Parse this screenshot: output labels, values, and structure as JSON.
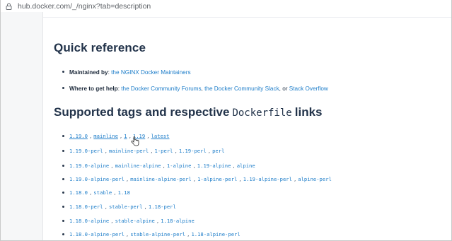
{
  "browser": {
    "url": "hub.docker.com/_/nginx?tab=description"
  },
  "quick_reference": {
    "title": "Quick reference",
    "maintained_label": "Maintained by",
    "maintained_sep": ": ",
    "maintained_value": "the NGINX Docker Maintainers",
    "help_label": "Where to get help",
    "help_sep": ": ",
    "help_link1": "the Docker Community Forums",
    "help_comma1": ", ",
    "help_link2": "the Docker Community Slack",
    "help_or": ", or ",
    "help_link3": "Stack Overflow"
  },
  "supported_tags": {
    "title_pre": "Supported tags and respective",
    "title_code": "Dockerfile",
    "title_post": "links",
    "rows": [
      {
        "tags": [
          "1.19.0",
          "mainline",
          "1",
          "1.19",
          "latest"
        ]
      },
      {
        "tags": [
          "1.19.0-perl",
          "mainline-perl",
          "1-perl",
          "1.19-perl",
          "perl"
        ]
      },
      {
        "tags": [
          "1.19.0-alpine",
          "mainline-alpine",
          "1-alpine",
          "1.19-alpine",
          "alpine"
        ]
      },
      {
        "tags": [
          "1.19.0-alpine-perl",
          "mainline-alpine-perl",
          "1-alpine-perl",
          "1.19-alpine-perl",
          "alpine-perl"
        ]
      },
      {
        "tags": [
          "1.18.0",
          "stable",
          "1.18"
        ]
      },
      {
        "tags": [
          "1.18.0-perl",
          "stable-perl",
          "1.18-perl"
        ]
      },
      {
        "tags": [
          "1.18.0-alpine",
          "stable-alpine",
          "1.18-alpine"
        ]
      },
      {
        "tags": [
          "1.18.0-alpine-perl",
          "stable-alpine-perl",
          "1.18-alpine-perl"
        ]
      }
    ],
    "separator": ","
  },
  "colors": {
    "link": "#1d7dc9",
    "heading": "#22334a",
    "text": "#2b3a4e"
  }
}
